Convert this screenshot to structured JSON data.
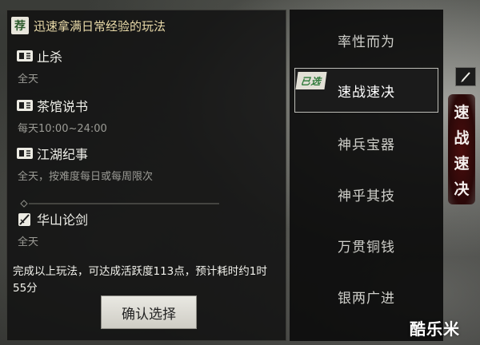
{
  "header": {
    "badge": "荐",
    "title": "迅速拿满日常经验的玩法"
  },
  "activities": [
    {
      "name": "止杀",
      "time": "全天",
      "icon": "scroll-book-icon"
    },
    {
      "name": "茶馆说书",
      "time": "每天10:00~24:00",
      "icon": "scroll-book-icon"
    },
    {
      "name": "江湖纪事",
      "time": "全天，按难度每日或每周限次",
      "icon": "scroll-book-icon"
    },
    {
      "name": "华山论剑",
      "time": "全天",
      "icon": "sword-scroll-icon"
    }
  ],
  "summary": "完成以上玩法，可达成活跃度113点，预计耗时约1时55分",
  "confirm_button": "确认选择",
  "options": [
    {
      "label": "率性而为",
      "selected": false
    },
    {
      "label": "速战速决",
      "selected": true
    },
    {
      "label": "神兵宝器",
      "selected": false
    },
    {
      "label": "神乎其技",
      "selected": false
    },
    {
      "label": "万贯铜钱",
      "selected": false
    },
    {
      "label": "银两广进",
      "selected": false
    }
  ],
  "selected_stamp": "已选",
  "side_seal": [
    "速",
    "战",
    "速",
    "决"
  ],
  "watermark": "酷乐米"
}
